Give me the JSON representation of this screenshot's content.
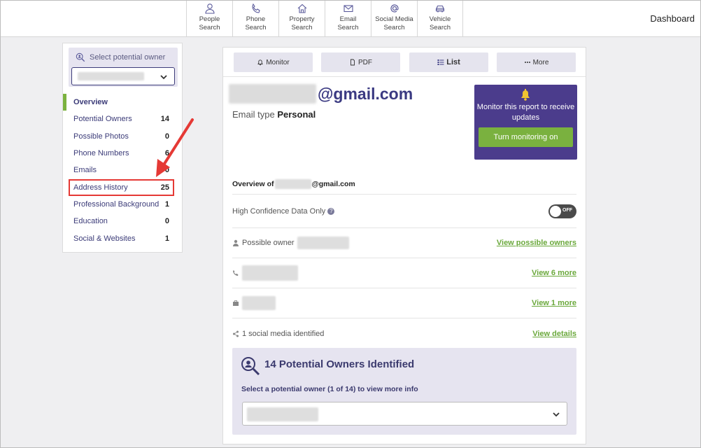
{
  "nav": {
    "items": [
      {
        "line1": "People",
        "line2": "Search",
        "icon": "person-icon"
      },
      {
        "line1": "Phone",
        "line2": "Search",
        "icon": "phone-icon"
      },
      {
        "line1": "Property",
        "line2": "Search",
        "icon": "house-icon"
      },
      {
        "line1": "Email",
        "line2": "Search",
        "icon": "envelope-icon"
      },
      {
        "line1": "Social Media",
        "line2": "Search",
        "icon": "at-icon"
      },
      {
        "line1": "Vehicle",
        "line2": "Search",
        "icon": "car-icon"
      }
    ],
    "dashboard": "Dashboard"
  },
  "sidebar": {
    "select_label": "Select potential owner",
    "items": [
      {
        "label": "Overview",
        "count": ""
      },
      {
        "label": "Potential Owners",
        "count": "14"
      },
      {
        "label": "Possible Photos",
        "count": "0"
      },
      {
        "label": "Phone Numbers",
        "count": "6"
      },
      {
        "label": "Emails",
        "count": "0"
      },
      {
        "label": "Address History",
        "count": "25"
      },
      {
        "label": "Professional Background",
        "count": "1"
      },
      {
        "label": "Education",
        "count": "0"
      },
      {
        "label": "Social & Websites",
        "count": "1"
      }
    ]
  },
  "toolbar": {
    "monitor": "Monitor",
    "pdf": "PDF",
    "list": "List",
    "more": "More"
  },
  "report": {
    "email_domain": "@gmail.com",
    "email_type_label": "Email type",
    "email_type_value": "Personal",
    "overview_prefix": "Overview of",
    "overview_suffix": "@gmail.com",
    "high_confidence_label": "High Confidence Data Only",
    "toggle_state": "OFF"
  },
  "monitor_card": {
    "text": "Monitor this report to receive updates",
    "button": "Turn monitoring on"
  },
  "info_rows": {
    "possible_owner_label": "Possible owner",
    "possible_owner_link": "View possible owners",
    "phone_link": "View 6 more",
    "job_link": "View 1 more",
    "social_label": "1 social media identified",
    "social_link": "View details"
  },
  "owners_panel": {
    "title": "14 Potential Owners Identified",
    "subtitle": "Select a potential owner (1 of 14) to view more info"
  },
  "colors": {
    "accent_purple": "#4b3c8c",
    "accent_green": "#7ab13f",
    "highlight_red": "#e53935"
  }
}
